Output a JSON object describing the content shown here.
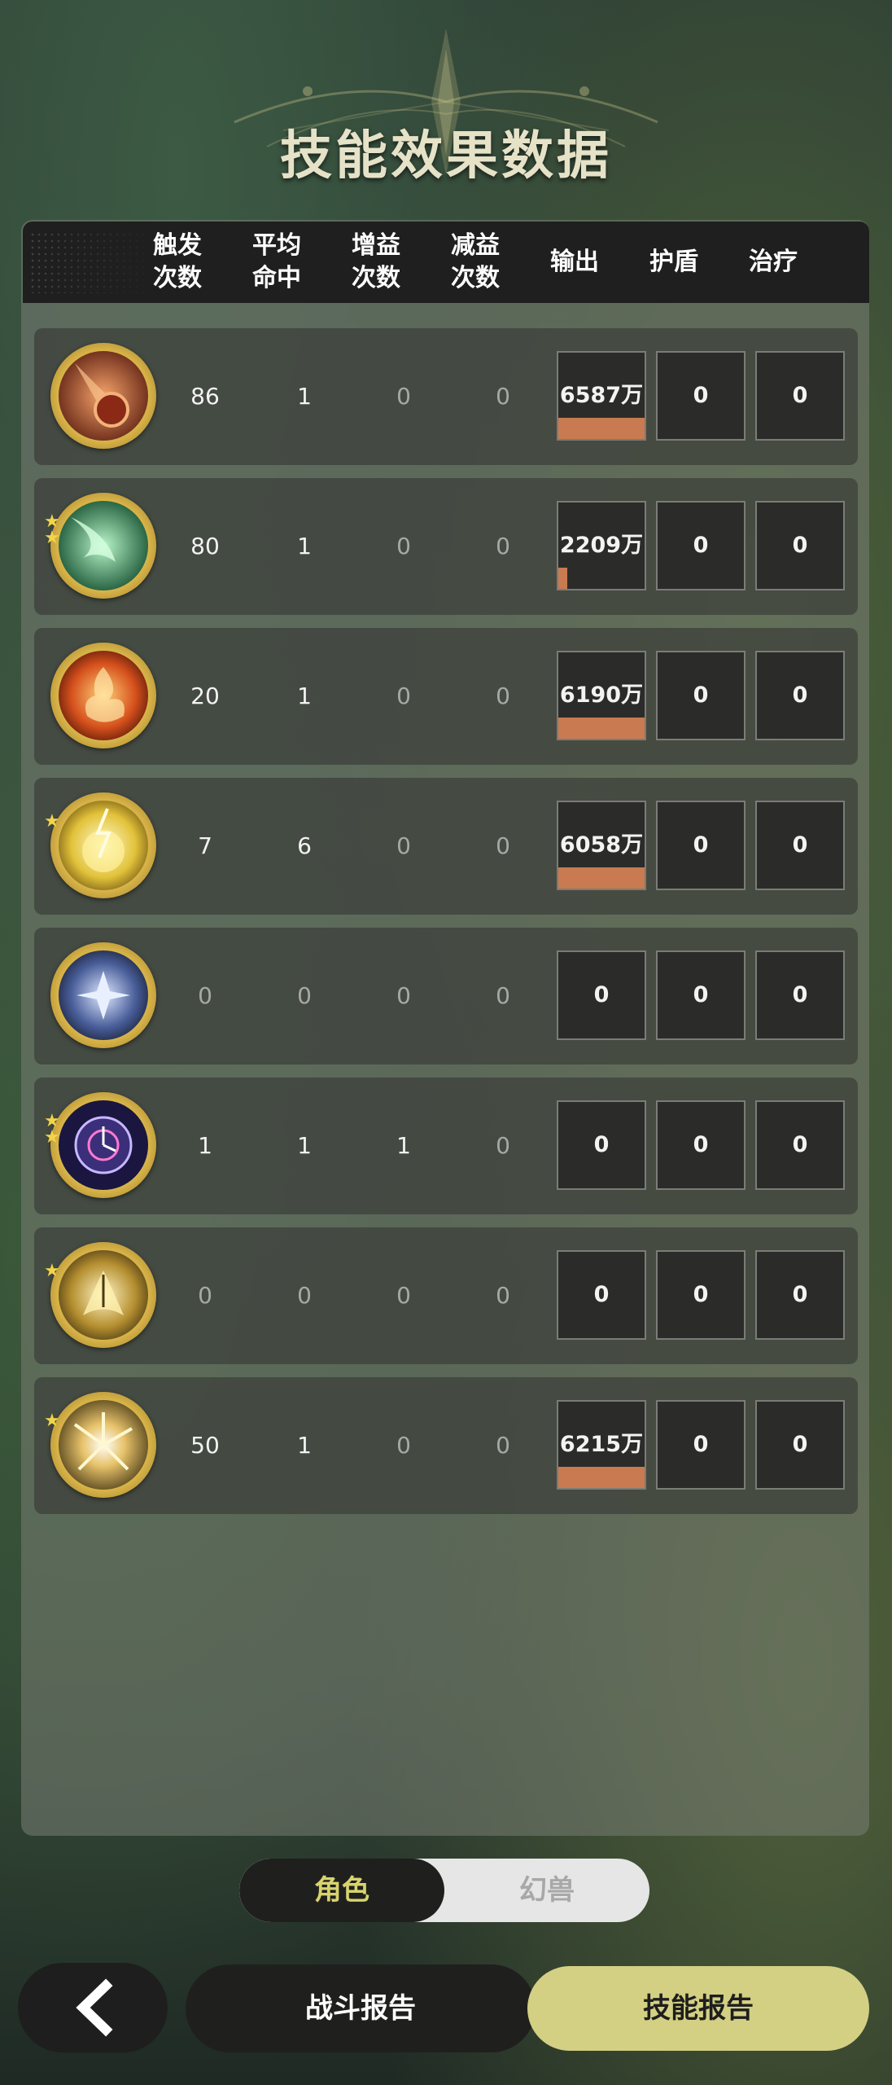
{
  "title": "技能效果数据",
  "columns": [
    "触发\n次数",
    "平均\n命中",
    "增益\n次数",
    "减益\n次数",
    "输出",
    "护盾",
    "治疗"
  ],
  "rows": [
    {
      "icon": "meteor-skill-icon",
      "stars": "",
      "trigger": "86",
      "avg_hit": "1",
      "buff": "0",
      "debuff": "0",
      "output": "6587万",
      "output_bar": 1.0,
      "shield": "0",
      "heal": "0"
    },
    {
      "icon": "green-wind-skill-icon",
      "stars": "★\n★",
      "trigger": "80",
      "avg_hit": "1",
      "buff": "0",
      "debuff": "0",
      "output": "2209万",
      "output_bar": 0.1,
      "shield": "0",
      "heal": "0"
    },
    {
      "icon": "fire-burst-skill-icon",
      "stars": "",
      "trigger": "20",
      "avg_hit": "1",
      "buff": "0",
      "debuff": "0",
      "output": "6190万",
      "output_bar": 1.0,
      "shield": "0",
      "heal": "0"
    },
    {
      "icon": "lightning-orb-skill-icon",
      "stars": "★",
      "trigger": "7",
      "avg_hit": "6",
      "buff": "0",
      "debuff": "0",
      "output": "6058万",
      "output_bar": 1.0,
      "shield": "0",
      "heal": "0"
    },
    {
      "icon": "blue-star-skill-icon",
      "stars": "",
      "trigger": "0",
      "avg_hit": "0",
      "buff": "0",
      "debuff": "0",
      "output": "0",
      "output_bar": 0,
      "shield": "0",
      "heal": "0"
    },
    {
      "icon": "arcane-clock-skill-icon",
      "stars": "★\n★",
      "trigger": "1",
      "avg_hit": "1",
      "buff": "1",
      "debuff": "0",
      "output": "0",
      "output_bar": 0,
      "shield": "0",
      "heal": "0"
    },
    {
      "icon": "golden-wing-skill-icon",
      "stars": "★",
      "trigger": "0",
      "avg_hit": "0",
      "buff": "0",
      "debuff": "0",
      "output": "0",
      "output_bar": 0,
      "shield": "0",
      "heal": "0"
    },
    {
      "icon": "golden-vortex-skill-icon",
      "stars": "★",
      "trigger": "50",
      "avg_hit": "1",
      "buff": "0",
      "debuff": "0",
      "output": "6215万",
      "output_bar": 1.0,
      "shield": "0",
      "heal": "0"
    }
  ],
  "toggle": {
    "active": "角色",
    "inactive": "幻兽"
  },
  "buttons": {
    "battle_report": "战斗报告",
    "skill_report": "技能报告"
  },
  "colors": {
    "accent": "#d3d083",
    "output_bar": "#c97a50",
    "active_toggle_text": "#d8d36e"
  }
}
